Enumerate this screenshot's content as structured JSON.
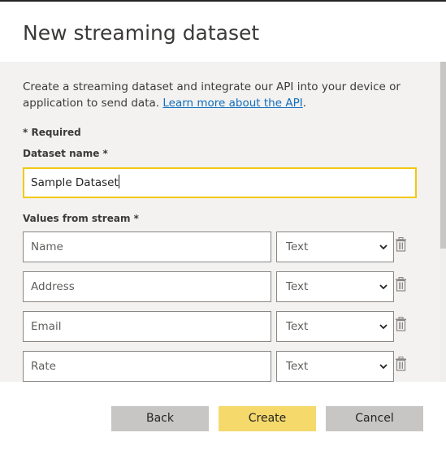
{
  "dialog": {
    "title": "New streaming dataset"
  },
  "description": {
    "text": "Create a streaming dataset and integrate our API into your device or application to send data. ",
    "link": "Learn more about the API",
    "end": "."
  },
  "form": {
    "required_note": "* Required",
    "dataset_name_label": "Dataset name *",
    "dataset_name_value": "Sample Dataset",
    "values_label": "Values from stream *",
    "rows": [
      {
        "placeholder": "Name",
        "type": "Text"
      },
      {
        "placeholder": "Address",
        "type": "Text"
      },
      {
        "placeholder": "Email",
        "type": "Text"
      },
      {
        "placeholder": "Rate",
        "type": "Text"
      }
    ]
  },
  "footer": {
    "back_label": "Back",
    "create_label": "Create",
    "cancel_label": "Cancel"
  },
  "colors": {
    "accent_yellow": "#f2c811",
    "create_button": "#f5d96b",
    "secondary_button": "#c8c6c4",
    "link": "#106ebe",
    "body_background": "#f3f2f1"
  },
  "icons": {
    "delete": "trash-icon",
    "dropdown": "chevron-down-icon"
  }
}
